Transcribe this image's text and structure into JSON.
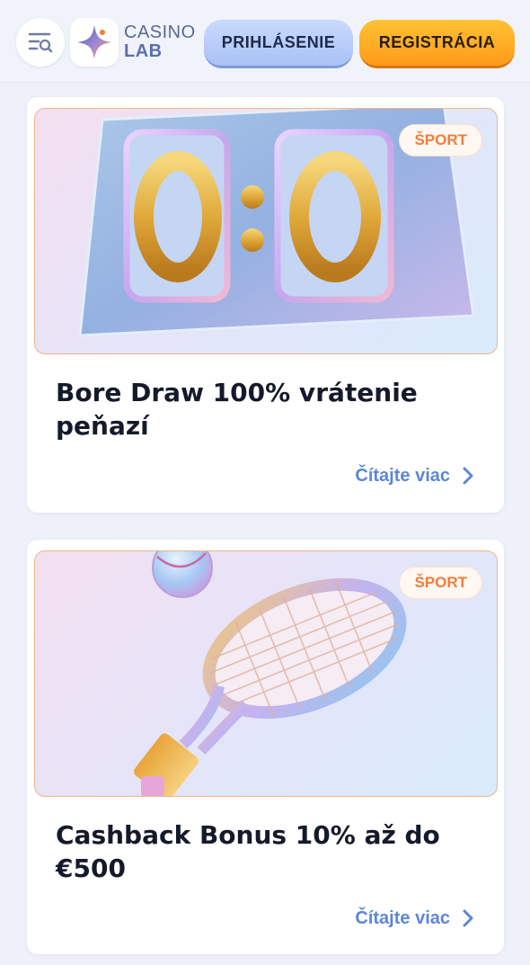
{
  "header": {
    "logo_line1": "CASINO",
    "logo_line2": "LAB",
    "login_label": "PRIHLÁSENIE",
    "register_label": "REGISTRÁCIA"
  },
  "promotions": [
    {
      "badge": "ŠPORT",
      "title": "Bore Draw 100% vrátenie peňazí",
      "read_more": "Čítajte viac",
      "image_icon": "scoreboard-0-0-icon"
    },
    {
      "badge": "ŠPORT",
      "title": "Cashback Bonus 10% až do €500",
      "read_more": "Čítajte viac",
      "image_icon": "tennis-racket-ball-icon"
    }
  ],
  "colors": {
    "accent_orange": "#ff9b1a",
    "login_blue": "#a9c2f5",
    "link_blue": "#5c86d8",
    "badge_orange": "#f07d3a"
  }
}
